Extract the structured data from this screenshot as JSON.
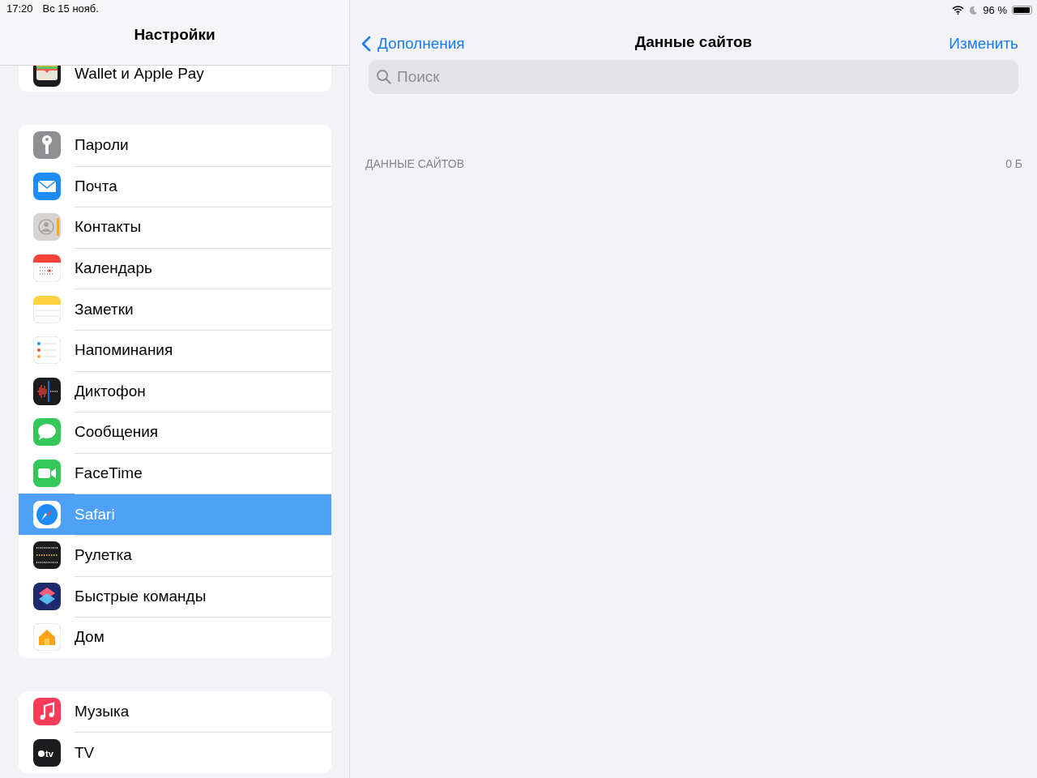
{
  "status_bar": {
    "time": "17:20",
    "date": "Вс 15 нояб.",
    "battery_text": "96 %",
    "level": 0.96
  },
  "sidebar": {
    "title": "Настройки",
    "groups": [
      {
        "cut_top": true,
        "items": [
          {
            "kind": "wallet",
            "label": "Wallet и Apple Pay",
            "selected": false
          }
        ]
      },
      {
        "cut_top": false,
        "items": [
          {
            "kind": "passwords",
            "label": "Пароли",
            "selected": false
          },
          {
            "kind": "mail",
            "label": "Почта",
            "selected": false
          },
          {
            "kind": "contacts",
            "label": "Контакты",
            "selected": false
          },
          {
            "kind": "calendar",
            "label": "Календарь",
            "selected": false
          },
          {
            "kind": "notes",
            "label": "Заметки",
            "selected": false
          },
          {
            "kind": "reminders",
            "label": "Напоминания",
            "selected": false
          },
          {
            "kind": "voice",
            "label": "Диктофон",
            "selected": false
          },
          {
            "kind": "messages",
            "label": "Сообщения",
            "selected": false
          },
          {
            "kind": "facetime",
            "label": "FaceTime",
            "selected": false
          },
          {
            "kind": "safari",
            "label": "Safari",
            "selected": true
          },
          {
            "kind": "measure",
            "label": "Рулетка",
            "selected": false
          },
          {
            "kind": "shortcuts",
            "label": "Быстрые команды",
            "selected": false
          },
          {
            "kind": "home",
            "label": "Дом",
            "selected": false
          }
        ]
      },
      {
        "cut_top": false,
        "items": [
          {
            "kind": "music",
            "label": "Музыка",
            "selected": false
          },
          {
            "kind": "tv",
            "label": "TV",
            "icon_text": "tv",
            "selected": false
          }
        ]
      }
    ]
  },
  "detail": {
    "back": "Дополнения",
    "title": "Данные сайтов",
    "action": "Изменить",
    "search": {
      "placeholder": "Поиск"
    },
    "section": {
      "header": "ДАННЫЕ САЙТОВ",
      "size": "0 Б"
    }
  }
}
